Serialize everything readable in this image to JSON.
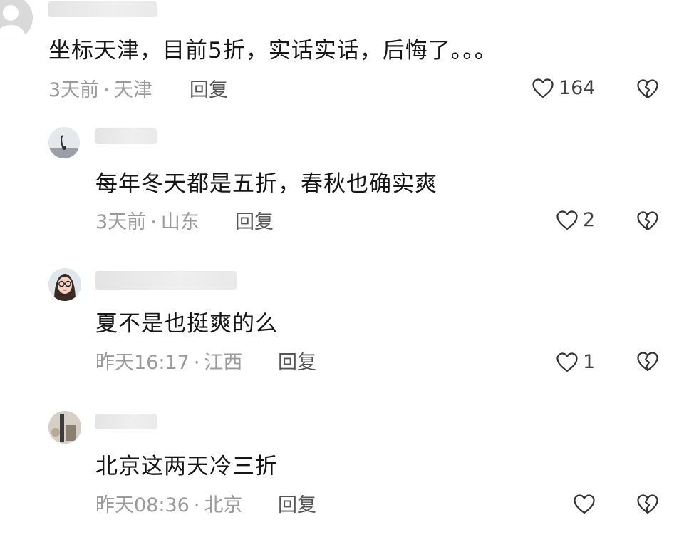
{
  "comments": [
    {
      "text": "坐标天津，目前5折，实话实话，后悔了。。。",
      "time": "3天前",
      "location": "天津",
      "reply_label": "回复",
      "likes": "164",
      "avatar": "default-avatar"
    },
    {
      "text": "每年冬天都是五折，春秋也确实爽",
      "time": "3天前",
      "location": "山东",
      "reply_label": "回复",
      "likes": "2",
      "avatar": "user-avatar"
    },
    {
      "text": "夏不是也挺爽的么",
      "time": "昨天16:17",
      "location": "江西",
      "reply_label": "回复",
      "likes": "1",
      "avatar": "user-avatar-glasses"
    },
    {
      "text": "北京这两天冷三折",
      "time": "昨天08:36",
      "location": "北京",
      "reply_label": "回复",
      "likes": "",
      "avatar": "user-avatar"
    }
  ],
  "meta_separator": "·",
  "icons": {
    "like": "heart-outline-icon",
    "dislike": "broken-heart-icon"
  },
  "colors": {
    "text": "#161616",
    "meta": "#9a9a9a",
    "reply": "#555555",
    "icon": "#333333"
  }
}
